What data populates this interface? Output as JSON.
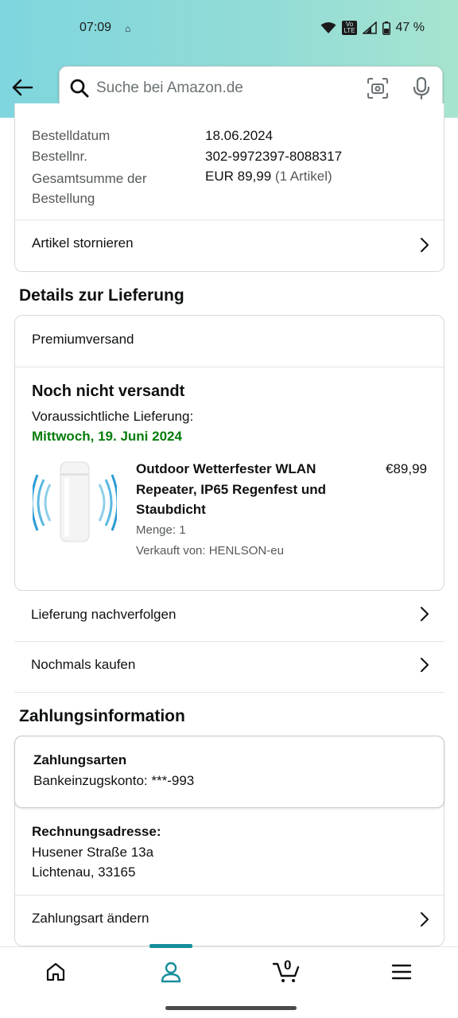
{
  "status_bar": {
    "time": "07:09",
    "battery": "47 %",
    "volte": "Vo\nLTE"
  },
  "search": {
    "placeholder": "Suche bei Amazon.de"
  },
  "order_summary": {
    "rows": [
      {
        "label": "Bestelldatum",
        "value": "18.06.2024"
      },
      {
        "label": "Bestellnr.",
        "value": "302-9972397-8088317"
      },
      {
        "label": "Gesamtsumme der Bestellung",
        "value": "EUR 89,99",
        "note": "(1 Artikel)"
      }
    ],
    "cancel_label": "Artikel stornieren"
  },
  "delivery": {
    "title": "Details zur Lieferung",
    "shipping_method": "Premiumversand",
    "status": "Noch nicht versandt",
    "expected_label": "Voraussichtliche Lieferung:",
    "expected_date": "Mittwoch, 19. Juni 2024",
    "item": {
      "title": "Outdoor Wetterfester WLAN Repeater, IP65 Regenfest und Staubdicht",
      "price": "€89,99",
      "quantity": "Menge: 1",
      "seller": "Verkauft von: HENLSON-eu"
    },
    "track_label": "Lieferung nachverfolgen",
    "buy_again_label": "Nochmals kaufen"
  },
  "payment": {
    "title": "Zahlungsinformation",
    "methods_title": "Zahlungsarten",
    "method_value": "Bankeinzugskonto: ***-993",
    "billing_title": "Rechnungsadresse:",
    "billing_line1": "Husener Straße 13a",
    "billing_line2": "Lichtenau, 33165",
    "change_label": "Zahlungsart ändern"
  },
  "bottom_nav": {
    "cart_count": "0"
  },
  "colors": {
    "accent": "#178e9c",
    "delivery_green": "#067d0b"
  }
}
